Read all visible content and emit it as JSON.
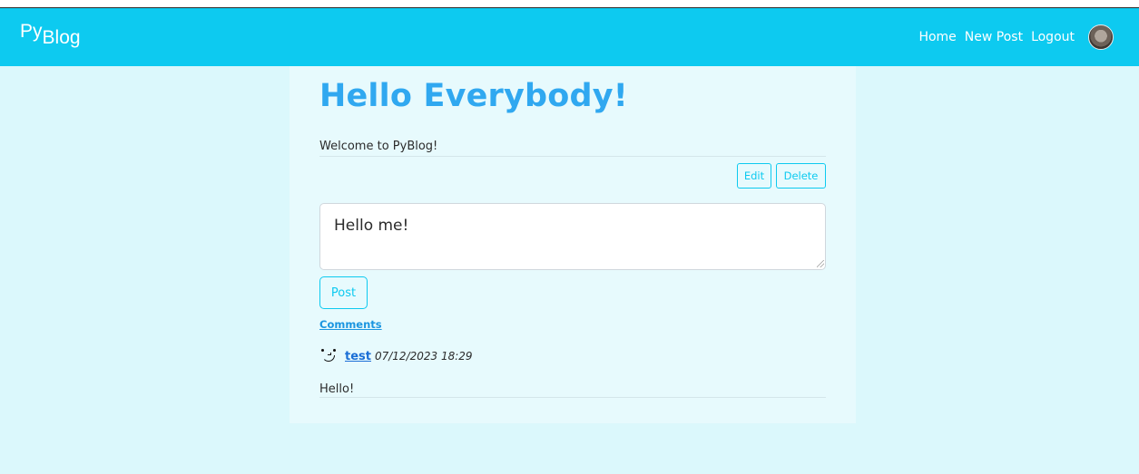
{
  "navbar": {
    "brand_py": "Py",
    "brand_blog": "Blog",
    "links": [
      "Home",
      "New Post",
      "Logout"
    ]
  },
  "post": {
    "title": "Hello Everybody!",
    "body": "Welcome to PyBlog!",
    "edit_label": "Edit",
    "delete_label": "Delete"
  },
  "comment_form": {
    "value": "Hello me!",
    "submit_label": "Post"
  },
  "comments": {
    "heading": "Comments",
    "items": [
      {
        "author": "test",
        "date": "07/12/2023 18:29",
        "text": "Hello!"
      }
    ]
  },
  "colors": {
    "navbar": "#0dcaf0",
    "page_background": "#dbf8fc",
    "title": "#30a8f0"
  }
}
